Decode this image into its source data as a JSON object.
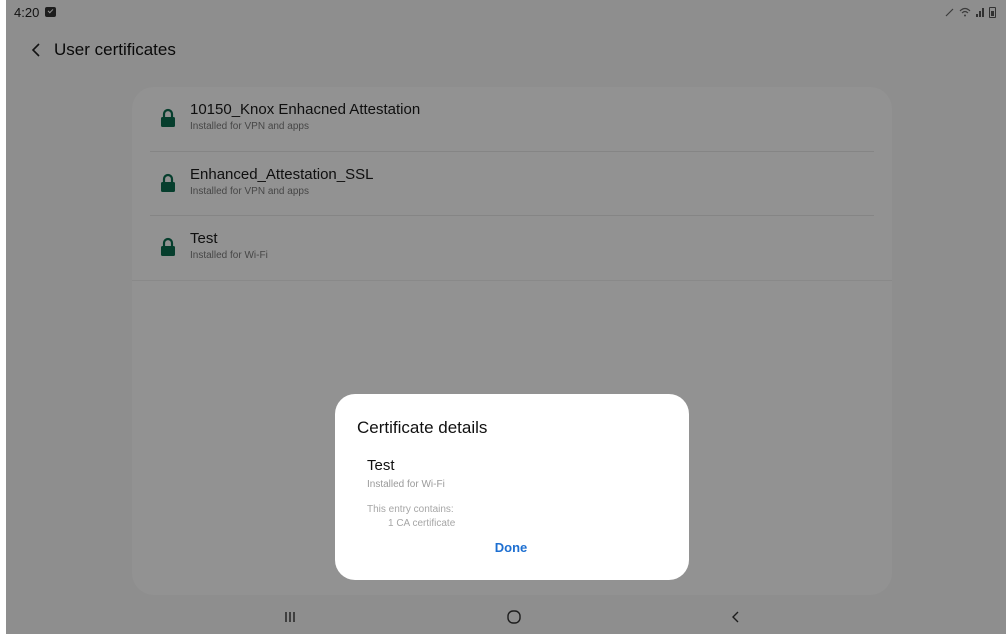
{
  "status_bar": {
    "time": "4:20"
  },
  "header": {
    "title": "User certificates"
  },
  "certificates": [
    {
      "name": "10150_Knox Enhacned Attestation",
      "subtitle": "Installed for VPN and apps"
    },
    {
      "name": "Enhanced_Attestation_SSL",
      "subtitle": "Installed for VPN and apps"
    },
    {
      "name": "Test",
      "subtitle": "Installed for Wi-Fi"
    }
  ],
  "dialog": {
    "title": "Certificate details",
    "cert_name": "Test",
    "cert_subtitle": "Installed for Wi-Fi",
    "contains_label": "This entry contains:",
    "contains_value": "1 CA certificate",
    "done_label": "Done"
  },
  "colors": {
    "lock": "#0c6b4f",
    "accent": "#1d6fd1"
  },
  "icons": {
    "back": "chevron-left-icon",
    "lock": "lock-icon",
    "recents": "recents-icon",
    "home": "home-icon",
    "nav_back": "nav-back-icon"
  }
}
